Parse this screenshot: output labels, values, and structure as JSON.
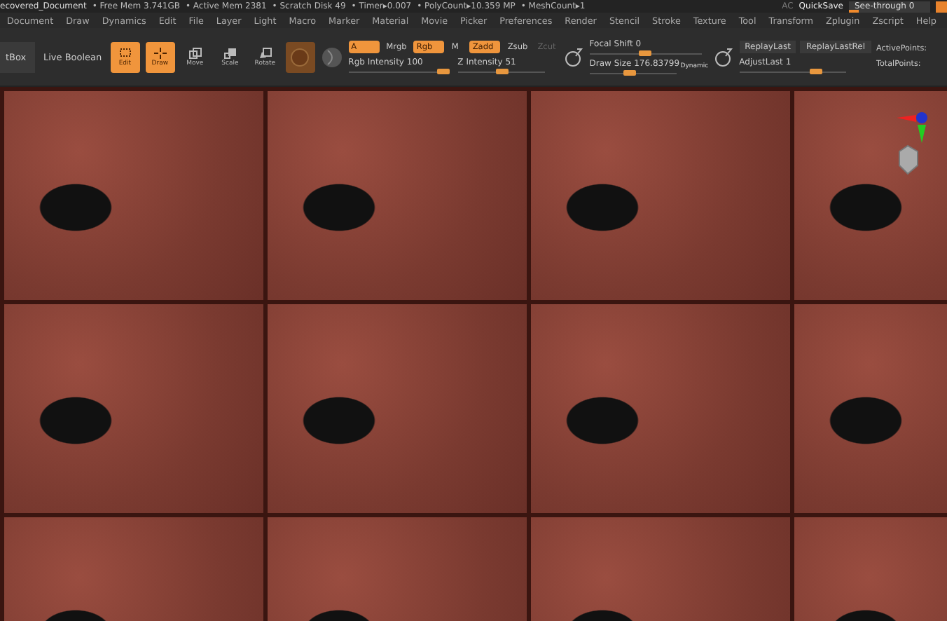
{
  "status_bar": {
    "document": "ecovered_Document",
    "stats": [
      "• Free Mem 3.741GB",
      "• Active Mem 2381",
      "• Scratch Disk 49",
      "• Timer▸0.007",
      "• PolyCount▸10.359 MP",
      "• MeshCount▸1"
    ],
    "ac": "AC",
    "quicksave": "QuickSave",
    "see_through": {
      "label": "See-through 0",
      "level": 0
    }
  },
  "menu": [
    "Document",
    "Draw",
    "Dynamics",
    "Edit",
    "File",
    "Layer",
    "Light",
    "Macro",
    "Marker",
    "Material",
    "Movie",
    "Picker",
    "Preferences",
    "Render",
    "Stencil",
    "Stroke",
    "Texture",
    "Tool",
    "Transform",
    "Zplugin",
    "Zscript",
    "Help"
  ],
  "toolbar": {
    "left_buttons": [
      "tBox",
      "Live Boolean"
    ],
    "modes": [
      {
        "label": "Edit",
        "kind": "edit",
        "selected": true
      },
      {
        "label": "Draw",
        "kind": "draw",
        "selected": true
      },
      {
        "label": "Move",
        "kind": "move",
        "selected": false
      },
      {
        "label": "Scale",
        "kind": "scale",
        "selected": false
      },
      {
        "label": "Rotate",
        "kind": "rotate",
        "selected": false
      }
    ],
    "channels_row1": [
      {
        "label": "A",
        "selected": true,
        "disabled": false
      },
      {
        "label": "Mrgb",
        "selected": false,
        "disabled": false
      },
      {
        "label": "Rgb",
        "selected": true,
        "disabled": false
      },
      {
        "label": "M",
        "selected": false,
        "disabled": false
      },
      {
        "label": "Zadd",
        "selected": true,
        "disabled": false
      },
      {
        "label": "Zsub",
        "selected": false,
        "disabled": false
      },
      {
        "label": "Zcut",
        "selected": false,
        "disabled": true
      }
    ],
    "rgb_intensity": {
      "label": "Rgb Intensity 100",
      "level": 1
    },
    "z_intensity": {
      "label": "Z Intensity 51",
      "level": 0.51
    },
    "focal_shift": {
      "label": "Focal Shift 0",
      "level": 0.5
    },
    "draw_size": {
      "label": "Draw Size 176.83799",
      "level": 0.45
    },
    "dynamic": "Dynamic",
    "replay_buttons": [
      "ReplayLast",
      "ReplayLastRel"
    ],
    "adjust_last": {
      "label": "AdjustLast 1",
      "level": 0.75
    },
    "points": [
      "ActivePoints:",
      "TotalPoints:"
    ]
  }
}
